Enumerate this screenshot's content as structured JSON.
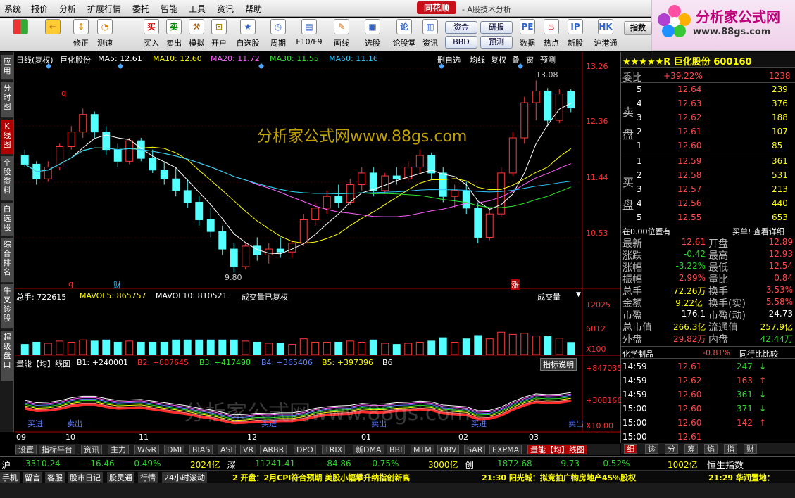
{
  "menu": [
    "系统",
    "报价",
    "分析",
    "扩展行情",
    "委托",
    "智能",
    "工具",
    "资讯",
    "帮助"
  ],
  "brand": "同花顺",
  "app_title": "- A股技术分析",
  "logo": {
    "text": "分析家公式网",
    "url": "www.88gs.com"
  },
  "toolbar": [
    "修正",
    "测速",
    "买入",
    "卖出",
    "模拟",
    "开户",
    "自选股",
    "周期",
    "F10/F9",
    "画线",
    "选股",
    "论股堂",
    "资讯",
    "数据",
    "热点",
    "新股",
    "沪港通"
  ],
  "toolbar_buttons": [
    "资金",
    "研报",
    "BBD",
    "预测",
    "指数",
    "板块",
    "基金",
    "个股"
  ],
  "left_tabs": [
    "应用",
    "分时图",
    "K线图",
    "个股资料",
    "自选股",
    "综合排名",
    "牛叉诊股",
    "超级盘口"
  ],
  "chart_header": {
    "period": "日线(复权)",
    "name": "巨化股份",
    "ma5": "MA5: 12.61",
    "ma10": "MA10: 12.60",
    "ma20": "MA20: 11.72",
    "ma30": "MA30: 11.55",
    "ma60": "MA60: 11.16"
  },
  "chart_buttons": [
    "删自选",
    "均线",
    "复权",
    "叠",
    "窗",
    "预测"
  ],
  "price_axis": [
    "13.26",
    "12.36",
    "11.44",
    "10.53"
  ],
  "hi_label": "13.08",
  "lo_label": "9.80",
  "mark_q": "q",
  "mark_cai": "财",
  "mark_zhang": "涨",
  "watermark_top": "分析家公式网www.88gs.com",
  "watermark_bottom": "分析家公式网www.88gs.com",
  "vol_header": {
    "total": "总手: 722615",
    "mavol5": "MAVOL5: 865757",
    "mavol10": "MAVOL10: 810521",
    "note": "成交量已复权",
    "sel": "成交量"
  },
  "vol_axis": [
    "12025",
    "6012",
    "X100"
  ],
  "ind_header": {
    "name": "量能【均】线图",
    "b1": "B1: +240001",
    "b2": "B2: +807645",
    "b3": "B3: +417498",
    "b4": "B4: +365406",
    "b5": "B5: +397396",
    "b6": "B6",
    "btn": "指标说明"
  },
  "ind_axis": [
    "+847035",
    "+308166",
    "X10.00"
  ],
  "ind_marks": [
    "买进",
    "卖出",
    "买进",
    "卖出",
    "买进",
    "卖出"
  ],
  "x_axis": [
    "09",
    "10",
    "11",
    "12",
    "01",
    "02",
    "03"
  ],
  "bottom_tabs": [
    "设置",
    "指标平台",
    "资讯",
    "主力",
    "W&R",
    "DMI",
    "BIAS",
    "ASI",
    "VR",
    "ARBR",
    "DPO",
    "TRIX",
    "新DMA",
    "BBI",
    "MTM",
    "OBV",
    "SAR",
    "EXPMA",
    "量能【均】线图"
  ],
  "right_tabs": [
    "细",
    "诊",
    "分",
    "筹",
    "焰",
    "指",
    "财"
  ],
  "stock": {
    "title": "★★★★★R 巨化股份 600160",
    "weibi_label": "委比",
    "weibi": "+39.22%",
    "weibi_r": "1238",
    "sell_label": "卖盘",
    "buy_label": "买盘",
    "sell": [
      [
        "5",
        "12.64",
        "239"
      ],
      [
        "4",
        "12.63",
        "376"
      ],
      [
        "3",
        "12.62",
        "188"
      ],
      [
        "2",
        "12.61",
        "107"
      ],
      [
        "1",
        "12.60",
        "85"
      ]
    ],
    "buy": [
      [
        "1",
        "12.59",
        "361"
      ],
      [
        "2",
        "12.58",
        "531"
      ],
      [
        "3",
        "12.57",
        "213"
      ],
      [
        "4",
        "12.56",
        "440"
      ],
      [
        "5",
        "12.55",
        "653"
      ]
    ],
    "pos": "在0.00位置有",
    "pos_r": "买单! 查看详细",
    "quote": [
      [
        "最新",
        "12.61",
        "开盘",
        "12.89"
      ],
      [
        "涨跌",
        "-0.42",
        "最高",
        "12.93"
      ],
      [
        "涨幅",
        "-3.22%",
        "最低",
        "12.54"
      ],
      [
        "振幅",
        "2.99%",
        "量比",
        "0.84"
      ],
      [
        "总手",
        "72.26万",
        "换手",
        "3.53%"
      ],
      [
        "金额",
        "9.22亿",
        "换手(实)",
        "5.58%"
      ],
      [
        "市盈",
        "176.1",
        "市盈(动)",
        "24.73"
      ],
      [
        "总市值",
        "266.3亿",
        "流通值",
        "257.9亿"
      ],
      [
        "外盘",
        "29.82万",
        "内盘",
        "42.44万"
      ]
    ],
    "sector": "化学制品",
    "sector_chg": "-0.81%",
    "sector_btn": "同行比比较",
    "ticks": [
      [
        "14:59",
        "12.61",
        "247",
        "↓"
      ],
      [
        "14:59",
        "12.62",
        "163",
        "↑"
      ],
      [
        "14:59",
        "12.60",
        "361",
        "↓"
      ],
      [
        "15:00",
        "12.60",
        "371",
        "↓"
      ],
      [
        "15:00",
        "12.60",
        "142",
        "↑"
      ],
      [
        "15:00",
        "12.61",
        "",
        ""
      ]
    ]
  },
  "status": {
    "sh": "沪",
    "sh_val": "3310.24",
    "sh_chg": "-16.46",
    "sh_pct": "-0.49%",
    "sh_amt": "2024亿",
    "sz": "深",
    "sz_val": "11241.41",
    "sz_chg": "-84.86",
    "sz_pct": "-0.75%",
    "sz_amt": "3000亿",
    "cy": "创",
    "cy_val": "1872.68",
    "cy_chg": "-9.73",
    "cy_pct": "-0.52%",
    "cy_amt": "1002亿",
    "hs": "恒生指数"
  },
  "footer_tabs": [
    "手机",
    "留言",
    "客服",
    "股市日记",
    "股灵通",
    "行情",
    "24小时滚动"
  ],
  "news": [
    "2 开盘：2月CPI符合预期 美股小幅攀升纳指创新高",
    "21:30 阳光城：拟竞拍广物房地产45%股权",
    "21:29 华润置地："
  ],
  "chart_data": {
    "type": "candlestick",
    "title": "巨化股份 日线(复权)",
    "ylim": [
      9.6,
      13.35
    ],
    "high": 13.08,
    "low": 9.8,
    "last": 12.61,
    "x_labels": [
      "09",
      "10",
      "11",
      "12",
      "01",
      "02",
      "03"
    ],
    "ma": {
      "MA5": 12.61,
      "MA10": 12.6,
      "MA20": 11.72,
      "MA30": 11.55,
      "MA60": 11.16
    },
    "ohlc": [
      [
        11.8,
        11.9,
        11.6,
        11.65
      ],
      [
        11.65,
        11.7,
        11.3,
        11.4
      ],
      [
        11.4,
        11.7,
        11.35,
        11.6
      ],
      [
        11.6,
        12.0,
        11.55,
        11.95
      ],
      [
        11.95,
        12.3,
        11.9,
        12.2
      ],
      [
        12.2,
        12.6,
        12.1,
        12.5
      ],
      [
        12.5,
        12.55,
        12.1,
        12.2
      ],
      [
        12.2,
        12.3,
        11.8,
        11.9
      ],
      [
        11.9,
        12.0,
        11.6,
        11.7
      ],
      [
        11.7,
        12.1,
        11.65,
        12.05
      ],
      [
        12.05,
        12.1,
        11.7,
        11.75
      ],
      [
        11.75,
        11.9,
        11.5,
        11.55
      ],
      [
        11.55,
        11.7,
        11.3,
        11.4
      ],
      [
        11.4,
        11.6,
        11.1,
        11.2
      ],
      [
        11.2,
        11.4,
        10.9,
        11.0
      ],
      [
        11.0,
        11.1,
        10.6,
        10.7
      ],
      [
        10.7,
        10.9,
        10.4,
        10.5
      ],
      [
        10.5,
        10.6,
        10.1,
        10.2
      ],
      [
        10.2,
        10.3,
        9.8,
        9.9
      ],
      [
        9.9,
        10.3,
        9.85,
        10.25
      ],
      [
        10.25,
        10.4,
        10.0,
        10.1
      ],
      [
        10.1,
        10.3,
        9.95,
        10.2
      ],
      [
        10.2,
        10.4,
        10.05,
        10.15
      ],
      [
        10.15,
        10.35,
        10.05,
        10.3
      ],
      [
        10.3,
        10.8,
        10.25,
        10.7
      ],
      [
        10.7,
        11.0,
        10.6,
        10.9
      ],
      [
        10.9,
        11.2,
        10.8,
        11.1
      ],
      [
        11.1,
        11.3,
        10.9,
        11.0
      ],
      [
        11.0,
        11.4,
        10.95,
        11.3
      ],
      [
        11.3,
        11.6,
        11.2,
        11.5
      ],
      [
        11.5,
        11.6,
        11.1,
        11.2
      ],
      [
        11.2,
        11.5,
        11.15,
        11.45
      ],
      [
        11.45,
        11.6,
        11.3,
        11.4
      ],
      [
        11.4,
        11.7,
        11.35,
        11.6
      ],
      [
        11.6,
        11.9,
        11.5,
        11.8
      ],
      [
        11.8,
        11.85,
        11.4,
        11.5
      ],
      [
        11.5,
        11.6,
        11.0,
        11.1
      ],
      [
        11.1,
        11.3,
        10.9,
        11.2
      ],
      [
        11.2,
        11.35,
        10.8,
        10.9
      ],
      [
        10.9,
        11.0,
        10.3,
        10.4
      ],
      [
        10.4,
        10.9,
        10.35,
        10.8
      ],
      [
        10.8,
        11.6,
        10.75,
        11.5
      ],
      [
        11.5,
        12.2,
        11.45,
        12.1
      ],
      [
        12.1,
        12.8,
        12.0,
        12.7
      ],
      [
        12.7,
        13.08,
        12.4,
        12.9
      ],
      [
        12.9,
        12.95,
        12.3,
        12.4
      ],
      [
        12.4,
        12.93,
        12.35,
        12.85
      ],
      [
        12.89,
        12.93,
        12.54,
        12.61
      ]
    ],
    "volume": {
      "total": 722615,
      "MAVOL5": 865757,
      "MAVOL10": 810521,
      "ylim": [
        0,
        12025
      ],
      "unit": "X100"
    }
  }
}
